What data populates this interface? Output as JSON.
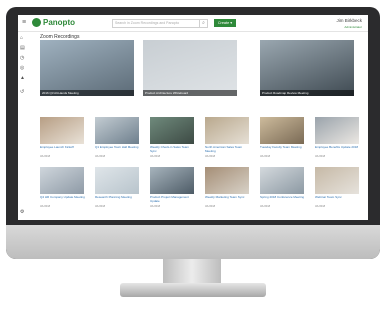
{
  "app": {
    "logo": "Panopto",
    "search_placeholder": "Search in Zoom Recordings and Panopto",
    "create_label": "Create ▾",
    "user_name": "Jim Birkbeck",
    "user_sub": "Administrator"
  },
  "folder": {
    "title": "Zoom Recordings"
  },
  "featured": [
    {
      "caption": "2016 Q3 All-Hands Meeting",
      "palette": [
        "#5c6b77",
        "#9fb1bf"
      ]
    },
    {
      "caption": "Product Architecture Whiteboard",
      "palette": [
        "#dfe3e6",
        "#c8ced3"
      ]
    },
    {
      "caption": "Product Roadmap Review Meeting",
      "palette": [
        "#3f4a52",
        "#9aa7b0"
      ]
    }
  ],
  "videos": [
    {
      "title": "Employee Launch Kickoff",
      "date": "3/1/2018",
      "palette": [
        "#e9e2d8",
        "#b79e84"
      ]
    },
    {
      "title": "Q1 Employee Town Hall Meeting",
      "date": "3/1/2018",
      "palette": [
        "#6e7f8d",
        "#c3ccd2"
      ]
    },
    {
      "title": "Weekly Check-in Sales Team Sync",
      "date": "3/1/2018",
      "palette": [
        "#3d4a44",
        "#6f8a7c"
      ]
    },
    {
      "title": "North American Sales Team Meeting",
      "date": "3/1/2018",
      "palette": [
        "#e6e0d6",
        "#b9a88d"
      ]
    },
    {
      "title": "Tuesday Faculty Team Meeting",
      "date": "3/1/2018",
      "palette": [
        "#7a6a55",
        "#cdbb9c"
      ]
    },
    {
      "title": "Employee Benefits Update 2018",
      "date": "3/1/2018",
      "palette": [
        "#ece8e3",
        "#9aa3ab"
      ]
    },
    {
      "title": "Q4 HR Company Update Meeting",
      "date": "3/1/2018",
      "palette": [
        "#8e9aa6",
        "#cfd6dc"
      ]
    },
    {
      "title": "Research Planning Meeting",
      "date": "3/1/2018",
      "palette": [
        "#b8c4cc",
        "#dfe5e9"
      ]
    },
    {
      "title": "Product Project Management Update",
      "date": "3/1/2018",
      "palette": [
        "#4d5b66",
        "#a7b4bd"
      ]
    },
    {
      "title": "Weekly Marketing Team Sync",
      "date": "3/1/2018",
      "palette": [
        "#d8d2c8",
        "#a58e76"
      ]
    },
    {
      "title": "Spring 2018 Conference Meeting",
      "date": "3/1/2018",
      "palette": [
        "#8c99a3",
        "#d4d9dd"
      ]
    },
    {
      "title": "Webinar Team Sync",
      "date": "3/1/2018",
      "palette": [
        "#e6e2dc",
        "#c6b9a6"
      ]
    }
  ],
  "sidebar_icons": [
    "home-icon",
    "folder-icon",
    "clock-icon",
    "globe-icon",
    "shared-icon",
    "history-icon",
    "settings-icon"
  ],
  "colors": {
    "brand": "#2f8a3a",
    "link": "#2a6fb0"
  }
}
